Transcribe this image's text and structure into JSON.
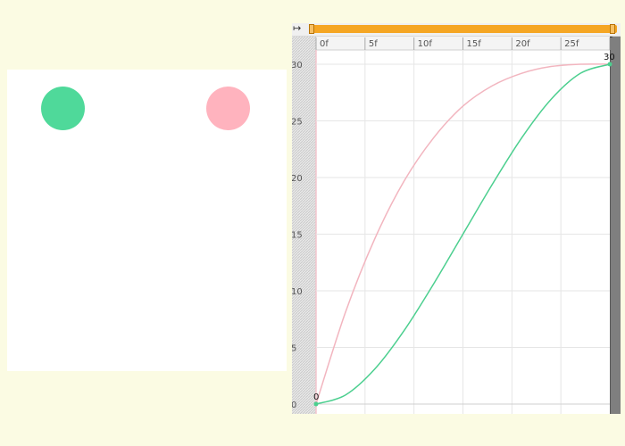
{
  "stage": {
    "background": "#ffffff",
    "balls": [
      {
        "name": "green-ball",
        "color": "#4fd99a"
      },
      {
        "name": "pink-ball",
        "color": "#ffb3be"
      }
    ]
  },
  "timeline": {
    "frame_labels": [
      "0f",
      "5f",
      "10f",
      "15f",
      "20f",
      "25f"
    ],
    "range_color": "#f5a623",
    "resize_icon": "resize-horizontal-icon",
    "resize_glyph": "↦"
  },
  "graph": {
    "y_tick_labels": [
      "30",
      "25",
      "20",
      "15",
      "10",
      "5",
      "0"
    ],
    "start_keyframe_label": "0",
    "end_keyframe_label": "30",
    "pink_color": "#f2b5bf",
    "green_color": "#4ccf8f"
  },
  "chart_data": {
    "type": "line",
    "xlim": [
      0,
      30
    ],
    "ylim": [
      0,
      30
    ],
    "grid": true,
    "x_unit": "frames",
    "series": [
      {
        "color": "#f2b5bf",
        "x": [
          0,
          3,
          6,
          9,
          12,
          15,
          18,
          21,
          24,
          27,
          30
        ],
        "y": [
          0,
          8.1,
          14.6,
          19.7,
          23.5,
          26.3,
          28.1,
          29.2,
          29.8,
          30.0,
          30.0
        ]
      },
      {
        "color": "#4ccf8f",
        "x": [
          0,
          3,
          6,
          9,
          12,
          15,
          18,
          21,
          24,
          27,
          30
        ],
        "y": [
          0,
          0.8,
          3.1,
          6.5,
          10.6,
          15.0,
          19.4,
          23.5,
          26.9,
          29.2,
          30.0
        ]
      }
    ]
  }
}
